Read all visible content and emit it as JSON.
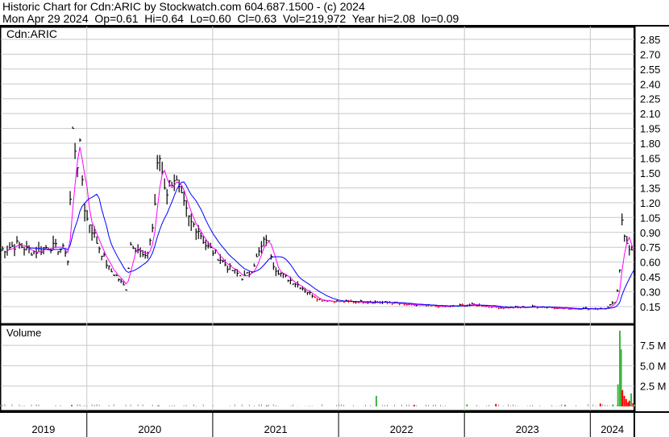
{
  "header": {
    "title": "Historic Chart for Cdn:ARIC by Stockwatch.com 604.687.1500 - (c) 2024",
    "quote": "Mon Apr 29 2024  Op=0.61  Hi=0.64  Lo=0.60  Cl=0.63  Vol=219,972  Year hi=2.08  lo=0.09"
  },
  "chart_data": {
    "type": "line",
    "symbol": "Cdn:ARIC",
    "volume_label": "Volume",
    "price_ticks": [
      "2.85",
      "2.70",
      "2.55",
      "2.40",
      "2.25",
      "2.10",
      "1.95",
      "1.80",
      "1.65",
      "1.50",
      "1.35",
      "1.20",
      "1.05",
      "0.90",
      "0.75",
      "0.60",
      "0.45",
      "0.30",
      "0.15"
    ],
    "ylim": [
      0.15,
      2.85
    ],
    "volume_ticks": [
      "7.5 M",
      "5.0 M",
      "2.5 M"
    ],
    "volume_ylim": [
      0,
      10000000
    ],
    "x_range": [
      2019.31,
      2024.35
    ],
    "years": [
      "2019",
      "2020",
      "2021",
      "2022",
      "2023",
      "2024"
    ],
    "close_series": [
      [
        2019.31,
        0.72
      ],
      [
        2019.45,
        0.78
      ],
      [
        2019.57,
        0.7
      ],
      [
        2019.7,
        0.76
      ],
      [
        2019.83,
        0.72
      ],
      [
        2019.85,
        0.6
      ],
      [
        2019.89,
        2.02
      ],
      [
        2019.92,
        1.55
      ],
      [
        2019.94,
        1.8
      ],
      [
        2019.99,
        1.05
      ],
      [
        2020.02,
        1.0
      ],
      [
        2020.08,
        0.8
      ],
      [
        2020.18,
        0.52
      ],
      [
        2020.24,
        0.45
      ],
      [
        2020.31,
        0.33
      ],
      [
        2020.35,
        0.8
      ],
      [
        2020.4,
        0.74
      ],
      [
        2020.47,
        0.62
      ],
      [
        2020.53,
        1.0
      ],
      [
        2020.57,
        1.72
      ],
      [
        2020.63,
        1.3
      ],
      [
        2020.69,
        1.48
      ],
      [
        2020.76,
        1.2
      ],
      [
        2020.82,
        1.0
      ],
      [
        2020.88,
        0.95
      ],
      [
        2020.95,
        0.76
      ],
      [
        2021.01,
        0.7
      ],
      [
        2021.11,
        0.56
      ],
      [
        2021.24,
        0.44
      ],
      [
        2021.3,
        0.5
      ],
      [
        2021.37,
        0.7
      ],
      [
        2021.43,
        0.86
      ],
      [
        2021.49,
        0.55
      ],
      [
        2021.56,
        0.46
      ],
      [
        2021.69,
        0.36
      ],
      [
        2021.75,
        0.3
      ],
      [
        2021.85,
        0.22
      ],
      [
        2022.01,
        0.2
      ],
      [
        2022.2,
        0.2
      ],
      [
        2022.42,
        0.19
      ],
      [
        2022.52,
        0.17
      ],
      [
        2022.84,
        0.15
      ],
      [
        2023.06,
        0.17
      ],
      [
        2023.29,
        0.14
      ],
      [
        2023.61,
        0.15
      ],
      [
        2023.8,
        0.13
      ],
      [
        2024.12,
        0.13
      ],
      [
        2024.2,
        0.2
      ],
      [
        2024.23,
        0.4
      ],
      [
        2024.25,
        1.05
      ],
      [
        2024.28,
        0.85
      ],
      [
        2024.33,
        0.7
      ],
      [
        2024.35,
        0.63
      ]
    ],
    "volume_spikes": [
      [
        2019.88,
        200000,
        "green"
      ],
      [
        2020.57,
        150000,
        "green"
      ],
      [
        2021.43,
        120000,
        "green"
      ],
      [
        2022.3,
        1300000,
        "green"
      ],
      [
        2022.6,
        200000,
        "red"
      ],
      [
        2023.02,
        250000,
        "green"
      ],
      [
        2023.25,
        300000,
        "red"
      ],
      [
        2023.8,
        200000,
        "green"
      ],
      [
        2024.08,
        350000,
        "red"
      ],
      [
        2024.18,
        250000,
        "green"
      ],
      [
        2024.22,
        2700000,
        "green"
      ],
      [
        2024.235,
        9300000,
        "green"
      ],
      [
        2024.245,
        7000000,
        "green"
      ],
      [
        2024.255,
        2000000,
        "red"
      ],
      [
        2024.27,
        1300000,
        "red"
      ],
      [
        2024.285,
        900000,
        "red"
      ],
      [
        2024.3,
        500000,
        "red"
      ],
      [
        2024.31,
        700000,
        "red"
      ],
      [
        2024.325,
        1600000,
        "green"
      ],
      [
        2024.34,
        400000,
        "red"
      ],
      [
        2024.35,
        220000,
        "green"
      ]
    ],
    "colors": {
      "price": "#000000",
      "down": "#ff0000",
      "ma_short": "#ff00ff",
      "ma_long": "#0000ff",
      "vol_up": "#3cb43c",
      "vol_down": "#ff0000",
      "grid": "#c8c8c8"
    }
  }
}
